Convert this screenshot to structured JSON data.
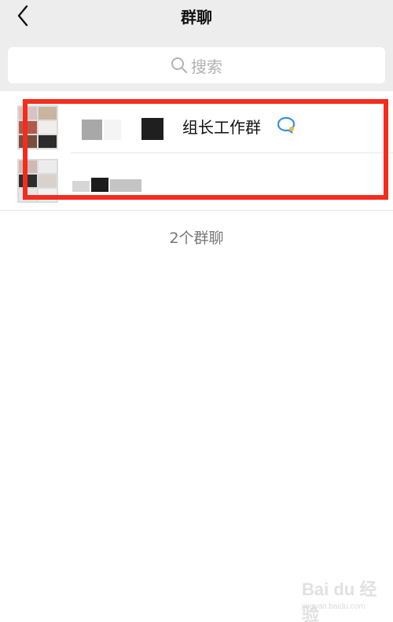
{
  "header": {
    "title": "群聊"
  },
  "search": {
    "placeholder": "搜索"
  },
  "groups": [
    {
      "name": "组长工作群"
    },
    {
      "name": ""
    }
  ],
  "footer": {
    "count_label": "2个群聊"
  },
  "watermark": {
    "brand": "Bai du 经验",
    "sub": "jingyan.baidu.com"
  },
  "colors": {
    "topbar_bg": "#ededed",
    "highlight": "#f42c1e",
    "icon_accent": "#3a8ee6"
  }
}
